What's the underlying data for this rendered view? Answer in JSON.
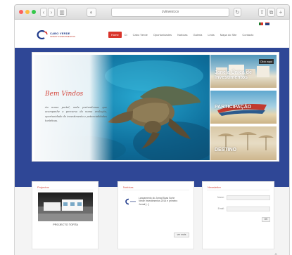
{
  "browser": {
    "url": "cvinvest.cv",
    "back": "‹",
    "forward": "›",
    "sidebar": "▥",
    "privacy": "◐",
    "share": "⇧",
    "tabs": "⧉",
    "plus": "+",
    "refresh": "↻"
  },
  "header": {
    "logo_title": "CABO VERDE",
    "logo_sub": "INVEST INVESTIMENTOS",
    "menu": [
      {
        "label": "Home",
        "active": true
      },
      {
        "label": "CI"
      },
      {
        "label": "Cabo Verde"
      },
      {
        "label": "Oportunidades"
      },
      {
        "label": "Notícias"
      },
      {
        "label": "Galeria"
      },
      {
        "label": "Links"
      },
      {
        "label": "Mapa do Site"
      },
      {
        "label": "Contacto"
      }
    ]
  },
  "slider": {
    "welcome_title": "Bem Vindos",
    "welcome_text": "Ao nosso portal, onde pretendemos que acompanhe o percurso da nossa evolução, oportunidade de investimento e potencialidades turísticas.",
    "thumbs": [
      {
        "label": "Janela Única de Investimentos",
        "badge": "Click aqui"
      },
      {
        "label": "PARTICIPAÇÃO"
      },
      {
        "label": "DESTINO"
      }
    ]
  },
  "widgets": {
    "projects": {
      "title": "Projectos",
      "caption": "PROJECTO TORTA"
    },
    "news": {
      "title": "Notícias",
      "text": "Lançamento do Jornal Boas Sorte Verde Investimentos 2014 e primeiro Jornal [...]",
      "more": "ver mais"
    },
    "newsletter": {
      "title": "Newsletter",
      "name_label": "Nome:",
      "email_label": "Email:",
      "submit": "OK"
    }
  },
  "colors": {
    "brand_red": "#d9342b",
    "brand_blue": "#2f4796"
  }
}
